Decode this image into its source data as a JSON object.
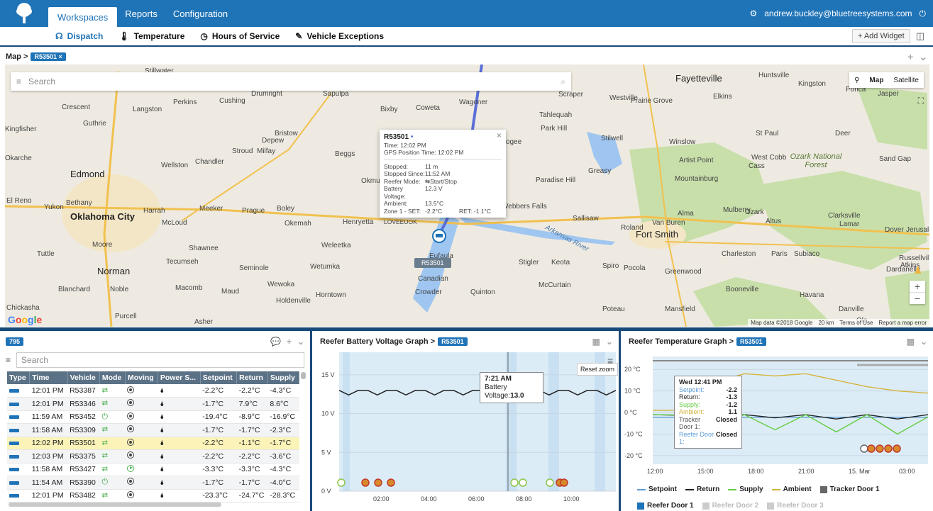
{
  "topbar": {
    "nav": [
      "Workspaces",
      "Reports",
      "Configuration"
    ],
    "user": "andrew.buckley@bluetreesystems.com"
  },
  "subnav": {
    "tabs": [
      "Dispatch",
      "Temperature",
      "Hours of Service",
      "Vehicle Exceptions"
    ],
    "add_widget": "+ Add Widget"
  },
  "map": {
    "breadcrumb": "Map >",
    "chip": "R53501",
    "search_placeholder": "Search",
    "map_type": [
      "Map",
      "Satellite"
    ],
    "attribution": [
      "Map data ©2018 Google",
      "20 km",
      "Terms of Use",
      "Report a map error"
    ],
    "cities_major": [
      "Oklahoma City",
      "Edmond",
      "Norman",
      "Fort Smith",
      "Fayetteville"
    ],
    "cities": [
      "Stillwater",
      "Sapulpa",
      "Cushing",
      "Drumright",
      "Perkins",
      "Crescent",
      "Langston",
      "Guthrie",
      "Kingfisher",
      "Stroud",
      "Milfay",
      "Depew",
      "Bristow",
      "Beggs",
      "Chandler",
      "Wellston",
      "Okarche",
      "El Reno",
      "Yukon",
      "Bethany",
      "Harrah",
      "McLoud",
      "Meeker",
      "Prague",
      "Boley",
      "Shawnee",
      "Tecumseh",
      "Moore",
      "Tuttle",
      "Blanchard",
      "Noble",
      "Macomb",
      "Maud",
      "Wewoka",
      "Seminole",
      "Weleetka",
      "Wetumka",
      "Holdenville",
      "Horntown",
      "Purcell",
      "Asher",
      "Chickasha",
      "Okemah",
      "Henryetta",
      "Okmulgee",
      "Eufaula",
      "Canadian",
      "Crowder",
      "Quinton",
      "McCurtain",
      "Stigler",
      "Keota",
      "Spiro",
      "Pocola",
      "Greenwood",
      "Charleston",
      "Paris",
      "Subiaco",
      "Booneville",
      "Havana",
      "Danville",
      "Ola",
      "Mansfield",
      "Poteau",
      "Roland",
      "Van Buren",
      "Alma",
      "Mulberry",
      "Ozark",
      "Altus",
      "Clarksville",
      "Lamar",
      "Dover",
      "Russellville",
      "Dardanelle",
      "Atkins",
      "Jerusalem",
      "Huntsville",
      "Kingston",
      "Ponca",
      "Jasper",
      "Elkins",
      "Prairie Grove",
      "Westville",
      "Tahlequah",
      "Park Hill",
      "Stilwell",
      "Webbers Falls",
      "Sallisaw",
      "Paradise Hill",
      "Greasy",
      "Muskogee",
      "Wagoner",
      "Coweta",
      "Bixby",
      "Scraper",
      "Winslow",
      "Artist Point",
      "Mountainburg",
      "West Cobb",
      "Cass",
      "St Paul",
      "Deer",
      "Sand Gap",
      "Ozark National Forest"
    ],
    "lake_label": "Arkansas River",
    "popup": {
      "title": "R53501",
      "time": "Time: 12:02 PM",
      "gps": "GPS Position Time: 12:02 PM",
      "rows": [
        {
          "k": "Stopped:",
          "v": "11 m"
        },
        {
          "k": "Stopped Since:",
          "v": "11:52 AM"
        },
        {
          "k": "Reefer Mode:",
          "v": "Start/Stop"
        },
        {
          "k": "Battery Voltage:",
          "v": "12.3 V"
        },
        {
          "k": "Ambient:",
          "v": "13.5°C"
        },
        {
          "k": "Zone 1 - SET:",
          "v": "-2.2°C",
          "extra": "RET: -1.1°C"
        }
      ],
      "footer": "LOVEEUOK"
    },
    "vehicle_tag": "R53501"
  },
  "list_panel": {
    "count_badge": "795",
    "search_placeholder": "Search",
    "columns": [
      "Type",
      "Time",
      "Vehicle",
      "Mode",
      "Moving",
      "Power S...",
      "Setpoint",
      "Return",
      "Supply"
    ],
    "rows": [
      {
        "time": "12:01 PM",
        "vehicle": "R53387",
        "mode": "⮂",
        "moving": "stop",
        "setpoint": "-2.2°C",
        "ret": "-2.2°C",
        "supply": "-4.3°C"
      },
      {
        "time": "12:01 PM",
        "vehicle": "R53346",
        "mode": "⮂",
        "moving": "stop",
        "setpoint": "-1.7°C",
        "ret": "7.9°C",
        "supply": "8.6°C"
      },
      {
        "time": "11:59 AM",
        "vehicle": "R53452",
        "mode": "⏻",
        "moving": "stop",
        "setpoint": "-19.4°C",
        "ret": "-8.9°C",
        "supply": "-16.9°C"
      },
      {
        "time": "11:58 AM",
        "vehicle": "R53309",
        "mode": "⮂",
        "moving": "stop",
        "setpoint": "-1.7°C",
        "ret": "-1.7°C",
        "supply": "-2.3°C"
      },
      {
        "time": "12:02 PM",
        "vehicle": "R53501",
        "mode": "⮂",
        "moving": "stop",
        "setpoint": "-2.2°C",
        "ret": "-1.1°C",
        "supply": "-1.7°C",
        "highlight": true
      },
      {
        "time": "12:03 PM",
        "vehicle": "R53375",
        "mode": "⮂",
        "moving": "stop",
        "setpoint": "-2.2°C",
        "ret": "-2.2°C",
        "supply": "-3.6°C"
      },
      {
        "time": "11:58 AM",
        "vehicle": "R53427",
        "mode": "⮂",
        "moving": "go",
        "setpoint": "-3.3°C",
        "ret": "-3.3°C",
        "supply": "-4.3°C"
      },
      {
        "time": "11:54 AM",
        "vehicle": "R53390",
        "mode": "⏻",
        "moving": "stop",
        "setpoint": "-1.7°C",
        "ret": "-1.7°C",
        "supply": "-4.0°C"
      },
      {
        "time": "12:01 PM",
        "vehicle": "R53482",
        "mode": "⮂",
        "moving": "stop",
        "setpoint": "-23.3°C",
        "ret": "-24.7°C",
        "supply": "-28.3°C"
      }
    ]
  },
  "battery_panel": {
    "title": "Reefer Battery Voltage Graph >",
    "chip": "R53501",
    "reset_zoom": "Reset zoom",
    "tooltip_time": "7:21 AM",
    "tooltip_label": "Battery Voltage:",
    "tooltip_value": "13.0"
  },
  "temp_panel": {
    "title": "Reefer Temperature Graph >",
    "chip": "R53501",
    "tooltip": {
      "title": "Wed 12:41 PM",
      "rows": [
        {
          "k": "Setpoint:",
          "v": "-2.2",
          "color": "#5b9bd5"
        },
        {
          "k": "Return:",
          "v": "-1.3",
          "color": "#222222"
        },
        {
          "k": "Supply:",
          "v": "-1.2",
          "color": "#66cc44"
        },
        {
          "k": "Ambient:",
          "v": "1.1",
          "color": "#d4b43c"
        },
        {
          "k": "Tracker Door 1:",
          "v": "Closed",
          "color": "#555555"
        },
        {
          "k": "Reefer Door 1:",
          "v": "Closed",
          "color": "#5b9bd5"
        }
      ]
    },
    "legend": [
      {
        "name": "Setpoint",
        "color": "#5b9bd5",
        "kind": "line"
      },
      {
        "name": "Return",
        "color": "#222222",
        "kind": "line"
      },
      {
        "name": "Supply",
        "color": "#66cc44",
        "kind": "line"
      },
      {
        "name": "Ambient",
        "color": "#d4b43c",
        "kind": "line"
      },
      {
        "name": "Tracker Door 1",
        "color": "#666666",
        "kind": "box"
      },
      {
        "name": "Reefer Door 1",
        "color": "#1f73b7",
        "kind": "box"
      },
      {
        "name": "Reefer Door 2",
        "color": "#cccccc",
        "kind": "box",
        "dim": true
      },
      {
        "name": "Reefer Door 3",
        "color": "#cccccc",
        "kind": "box",
        "dim": true
      }
    ]
  },
  "chart_data": [
    {
      "type": "line",
      "ylim": [
        0,
        17
      ],
      "yticks": [
        "0 V",
        "5 V",
        "10 V",
        "15 V"
      ],
      "xticks": [
        "02:00",
        "04:00",
        "06:00",
        "08:00",
        "10:00"
      ],
      "series": [
        {
          "name": "Battery Voltage",
          "values": [
            13,
            12.4,
            13,
            13,
            12.4,
            13,
            13,
            12.4,
            13,
            13,
            12.4,
            13,
            13,
            12.4,
            13,
            13,
            12.4,
            13,
            13,
            12.4,
            13,
            13,
            12.4,
            13,
            13,
            12.4,
            13,
            13,
            12.4,
            13
          ]
        }
      ]
    },
    {
      "type": "line",
      "ylim": [
        -24,
        26
      ],
      "yticks": [
        "-20 °C",
        "-10 °C",
        "0 °C",
        "10 °C",
        "20 °C"
      ],
      "xticks": [
        "12:00",
        "15:00",
        "18:00",
        "21:00",
        "15. Mar",
        "03:00"
      ],
      "series": [
        {
          "name": "Setpoint",
          "values": [
            -2.2,
            -2.2,
            -2.2,
            -2.2,
            -2.2,
            -2.2,
            -2.2,
            -2.2,
            -2.2,
            -2.2
          ]
        },
        {
          "name": "Return",
          "values": [
            -1,
            -1.3,
            -2,
            -1,
            -2.5,
            -1,
            -3,
            -1,
            -3,
            -1
          ]
        },
        {
          "name": "Supply",
          "values": [
            -1,
            -1.2,
            -6,
            -1,
            -8,
            -1,
            -9,
            -1,
            -10,
            -2
          ]
        },
        {
          "name": "Ambient",
          "values": [
            1,
            1.1,
            14,
            18,
            17,
            18,
            15,
            12,
            10,
            9
          ]
        }
      ]
    }
  ]
}
